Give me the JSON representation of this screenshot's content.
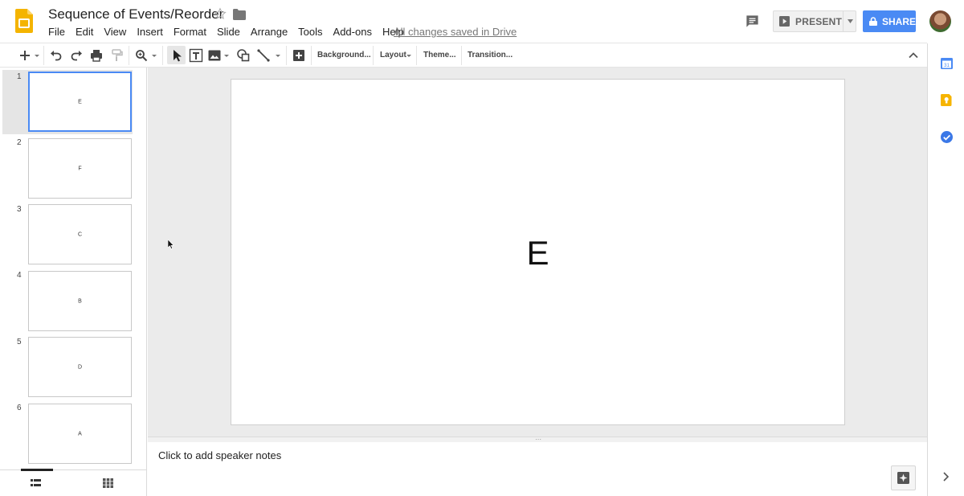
{
  "document": {
    "title": "Sequence of Events/Reorder",
    "save_status": "All changes saved in Drive"
  },
  "menubar": [
    "File",
    "Edit",
    "View",
    "Insert",
    "Format",
    "Slide",
    "Arrange",
    "Tools",
    "Add-ons",
    "Help"
  ],
  "header": {
    "present_label": "PRESENT",
    "share_label": "SHARE"
  },
  "toolbar": {
    "background_label": "Background...",
    "layout_label": "Layout",
    "theme_label": "Theme...",
    "transition_label": "Transition..."
  },
  "slides": [
    {
      "number": "1",
      "text": "E",
      "selected": true
    },
    {
      "number": "2",
      "text": "F"
    },
    {
      "number": "3",
      "text": "C"
    },
    {
      "number": "4",
      "text": "B"
    },
    {
      "number": "5",
      "text": "D"
    },
    {
      "number": "6",
      "text": "A"
    }
  ],
  "current_slide": {
    "text": "E"
  },
  "notes": {
    "placeholder": "Click to add speaker notes"
  },
  "colors": {
    "accent": "#4a8af4",
    "slides_logo": "#f4b400",
    "keep_icon": "#f6b400",
    "tasks_icon": "#3b78e7"
  },
  "icons": {
    "header": [
      "slides-logo-icon",
      "star-icon",
      "folder-icon",
      "comment-icon",
      "present-play-icon",
      "lock-icon"
    ],
    "toolbar": [
      "new-slide-icon",
      "undo-icon",
      "redo-icon",
      "print-icon",
      "paint-format-icon",
      "zoom-icon",
      "select-icon",
      "text-box-icon",
      "image-icon",
      "shape-icon",
      "line-icon",
      "comment-add-icon"
    ],
    "side": [
      "calendar-icon",
      "keep-icon",
      "tasks-icon"
    ]
  }
}
